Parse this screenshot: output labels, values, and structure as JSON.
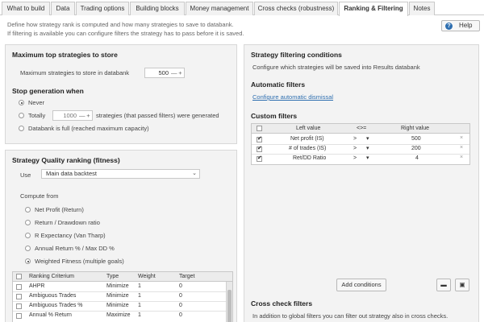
{
  "tabs": [
    {
      "label": "What to build"
    },
    {
      "label": "Data"
    },
    {
      "label": "Trading options"
    },
    {
      "label": "Building blocks"
    },
    {
      "label": "Money management"
    },
    {
      "label": "Cross checks (robustness)"
    },
    {
      "label": "Ranking & Filtering",
      "active": true
    },
    {
      "label": "Notes"
    }
  ],
  "description": {
    "line1": "Define how strategy rank is computed and how many strategies to save to databank.",
    "line2": "If filtering is available you can configure filters the strategy has to pass before it is saved."
  },
  "help_label": "Help",
  "max_top": {
    "title": "Maximum top strategies to store",
    "label": "Maximum strategies to store in databank",
    "value": "500",
    "minus": "—",
    "plus": "+"
  },
  "stop": {
    "title": "Stop generation when",
    "never": "Never",
    "totally": "Totally",
    "totally_value": "1000",
    "totally_suffix": "strategies (that passed filters) were generated",
    "full": "Databank is full (reached maximum capacity)"
  },
  "quality": {
    "title": "Strategy Quality ranking (fitness)",
    "use_label": "Use",
    "use_value": "Main data backtest",
    "compute_from": "Compute from",
    "options": [
      "Net Profit (Return)",
      "Return / Drawdown ratio",
      "R Expectancy (Van Tharp)",
      "Annual Return % / Max DD %",
      "Weighted Fitness (multiple goals)"
    ],
    "selected_index": 4,
    "table": {
      "headers": [
        "Ranking Criterium",
        "Type",
        "Weight",
        "Target"
      ],
      "rows": [
        {
          "criterium": "AHPR",
          "type": "Minimize",
          "weight": "1",
          "target": "0"
        },
        {
          "criterium": "Ambiguous Trades",
          "type": "Minimize",
          "weight": "1",
          "target": "0"
        },
        {
          "criterium": "Ambiguous Trades %",
          "type": "Minimize",
          "weight": "1",
          "target": "0"
        },
        {
          "criterium": "Annual % Return",
          "type": "Maximize",
          "weight": "1",
          "target": "0"
        }
      ]
    }
  },
  "filtering": {
    "title": "Strategy filtering conditions",
    "subtitle": "Configure which strategies will be saved into Results databank",
    "auto_title": "Automatic filters",
    "auto_link": "Configure automatic dismissal",
    "custom_title": "Custom filters",
    "headers": {
      "left": "Left value",
      "op": "<>=",
      "right": "Right value"
    },
    "rows": [
      {
        "left": "Net profit (IS)",
        "op": ">",
        "right": "500"
      },
      {
        "left": "# of trades (IS)",
        "op": ">",
        "right": "200"
      },
      {
        "left": "Ret/DD Ratio",
        "op": ">",
        "right": "4"
      }
    ],
    "add_label": "Add conditions",
    "cross_title": "Cross check filters",
    "cross_text": "In addition to global filters you can filter out strategy also in cross checks."
  }
}
